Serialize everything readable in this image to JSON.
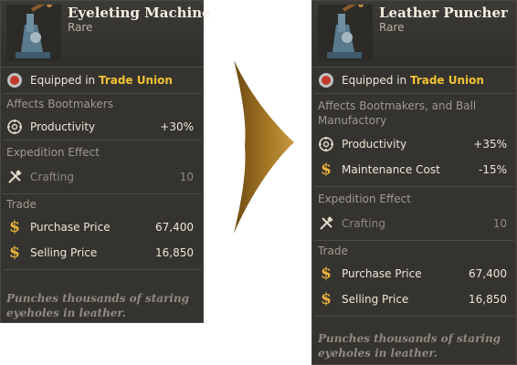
{
  "colors": {
    "background": "#34332f",
    "highlight": "#f2c234",
    "arrow": "#a4741f"
  },
  "left": {
    "title": "Eyeleting Machine",
    "rarity": "Rare",
    "equipped_prefix": "Equipped in ",
    "equipped_location": "Trade Union",
    "affects_label": "Affects Bootmakers",
    "stats": [
      {
        "icon": "gear-icon",
        "label": "Productivity",
        "value": "+30%"
      }
    ],
    "expedition_header": "Expedition Effect",
    "expedition": [
      {
        "icon": "crafting-tools-icon",
        "label": "Crafting",
        "value": "10"
      }
    ],
    "trade_header": "Trade",
    "trade": [
      {
        "icon": "dollar-icon",
        "label": "Purchase Price",
        "value": "67,400"
      },
      {
        "icon": "dollar-icon",
        "label": "Selling Price",
        "value": "16,850"
      }
    ],
    "flavor_line1": "Punches thousands of staring",
    "flavor_line2": "eyeholes in leather."
  },
  "right": {
    "title": "Leather Puncher",
    "rarity": "Rare",
    "equipped_prefix": "Equipped in ",
    "equipped_location": "Trade Union",
    "affects_line1": "Affects Bootmakers, and Ball",
    "affects_line2": "Manufactory",
    "stats": [
      {
        "icon": "gear-icon",
        "label": "Productivity",
        "value": "+35%"
      },
      {
        "icon": "dollar-icon",
        "label": "Maintenance Cost",
        "value": "-15%"
      }
    ],
    "expedition_header": "Expedition Effect",
    "expedition": [
      {
        "icon": "crafting-tools-icon",
        "label": "Crafting",
        "value": "10"
      }
    ],
    "trade_header": "Trade",
    "trade": [
      {
        "icon": "dollar-icon",
        "label": "Purchase Price",
        "value": "67,400"
      },
      {
        "icon": "dollar-icon",
        "label": "Selling Price",
        "value": "16,850"
      }
    ],
    "flavor_line1": "Punches thousands of staring",
    "flavor_line2": "eyeholes in leather."
  }
}
